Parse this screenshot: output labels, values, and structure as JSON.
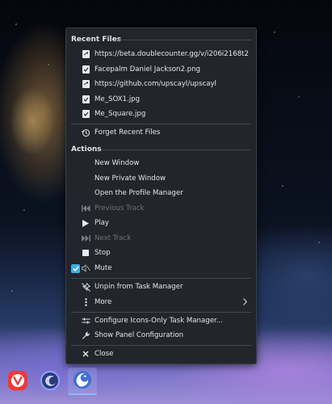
{
  "recent_files": {
    "header": "Recent Files",
    "items": [
      {
        "label": "https://beta.doublecounter.gg/v/i206i2168t2",
        "icon": "link-file-icon"
      },
      {
        "label": "Facepalm Daniel Jackson2.png",
        "icon": "image-file-icon"
      },
      {
        "label": "https://github.com/upscayl/upscayl",
        "icon": "link-file-icon"
      },
      {
        "label": "Me_SOX1.jpg",
        "icon": "image-file-icon"
      },
      {
        "label": "Me_Square.jpg",
        "icon": "image-file-icon"
      }
    ],
    "forget": "Forget Recent Files"
  },
  "actions": {
    "header": "Actions",
    "new_window": "New Window",
    "new_private_window": "New Private Window",
    "profile_manager": "Open the Profile Manager",
    "previous_track": "Previous Track",
    "play": "Play",
    "next_track": "Next Track",
    "stop": "Stop",
    "mute": "Mute",
    "mute_checked": true
  },
  "task": {
    "unpin": "Unpin from Task Manager",
    "more": "More",
    "configure": "Configure Icons-Only Task Manager...",
    "show_panel": "Show Panel Configuration",
    "close": "Close"
  },
  "taskbar": {
    "apps": [
      {
        "name": "vivaldi-icon",
        "color": "#ef3939"
      },
      {
        "name": "firefox-nightly-icon",
        "color": "#4a64c9"
      },
      {
        "name": "firefox-icon",
        "color": "#5e8de0",
        "active": true
      }
    ]
  },
  "colors": {
    "accent": "#3daee9",
    "menu_bg": "#22262c"
  }
}
